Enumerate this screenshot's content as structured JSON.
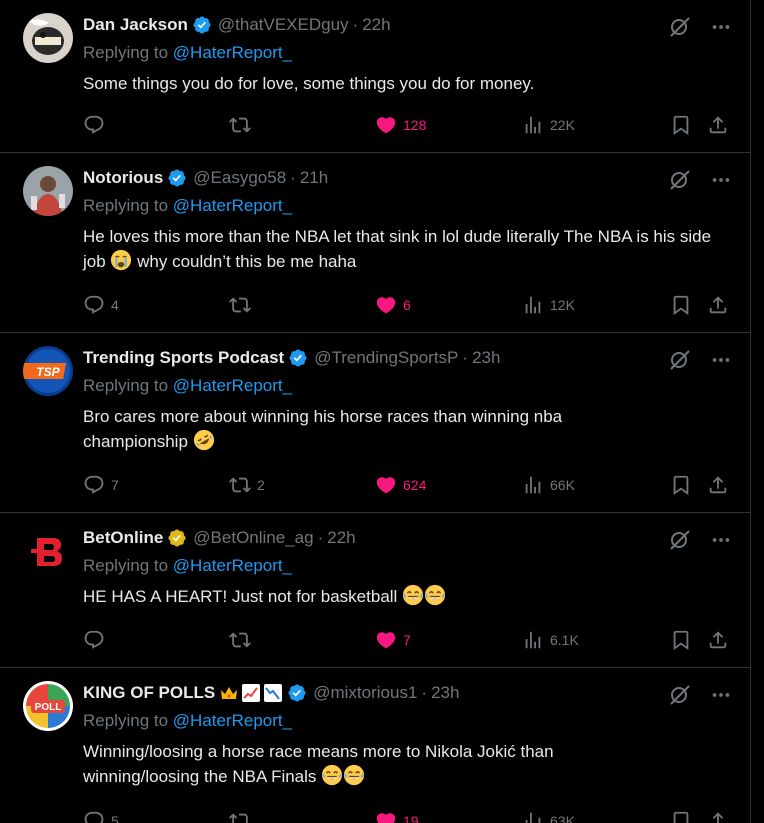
{
  "replying_label": "Replying to",
  "tweets": [
    {
      "name": "Dan Jackson",
      "badge": "blue-check",
      "handle": "@thatVEXEDguy",
      "dot": "·",
      "time": "22h",
      "mention": "@HaterReport_",
      "text": "Some things you do for love, some things you do for money.",
      "replies": "",
      "retweets": "",
      "likes": "128",
      "liked": true,
      "views": "22K"
    },
    {
      "name": "Notorious",
      "badge": "blue-check",
      "handle": "@Easygo58",
      "dot": "·",
      "time": "21h",
      "mention": "@HaterReport_",
      "text": "He loves this more than the NBA let that sink in lol dude literally The NBA is his side job",
      "text_after": " why couldn’t this be me haha",
      "emoji": "crying-face",
      "replies": "4",
      "retweets": "",
      "likes": "6",
      "liked": true,
      "views": "12K"
    },
    {
      "name": "Trending Sports Podcast",
      "badge": "blue-check",
      "handle": "@TrendingSportsP",
      "dot": "·",
      "time": "23h",
      "mention": "@HaterReport_",
      "text": "Bro cares more about winning his horse races than winning nba championship",
      "emoji": "rolling-laughing-face",
      "replies": "7",
      "retweets": "2",
      "likes": "624",
      "liked": true,
      "views": "66K"
    },
    {
      "name": "BetOnline",
      "badge": "gold-check",
      "handle": "@BetOnline_ag",
      "dot": "·",
      "time": "22h",
      "mention": "@HaterReport_",
      "text": "HE HAS A HEART! Just not for basketball",
      "emoji": "tears-of-joy-face",
      "replies": "",
      "retweets": "",
      "likes": "7",
      "liked": true,
      "views": "6.1K"
    },
    {
      "name": "KING OF POLLS",
      "badge": "blue-check",
      "handle": "@mixtorious1",
      "dot": "·",
      "time": "23h",
      "mention": "@HaterReport_",
      "text": "Winning/loosing a horse race means more to Nikola Jokić than winning/loosing the NBA Finals",
      "emoji": "tears-of-joy-face",
      "replies": "5",
      "retweets": "",
      "likes": "19",
      "liked": true,
      "views": "63K"
    }
  ],
  "avatar_texts": {
    "tsp": "TSP",
    "poll": "POLL"
  },
  "colors": {
    "background": "#000000",
    "text": "#e7e9ea",
    "muted": "#71767b",
    "link": "#1d9bf0",
    "like": "#f91880",
    "border": "#2f3336",
    "verified_blue": "#1d9bf0",
    "verified_gold": "#e2b719"
  }
}
